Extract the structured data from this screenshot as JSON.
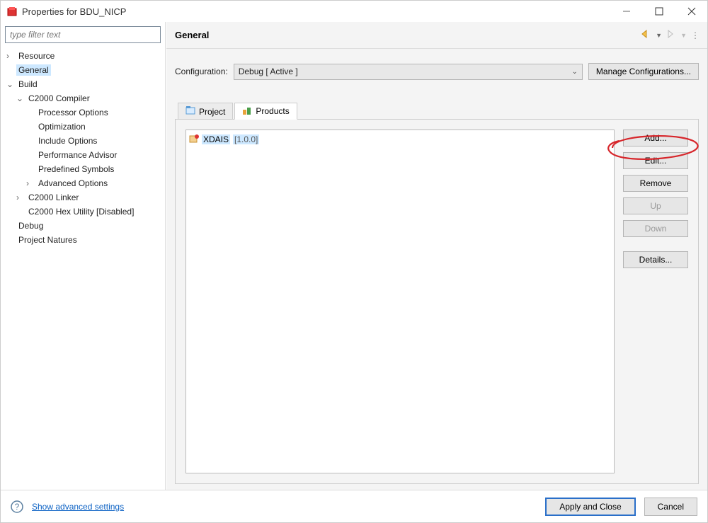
{
  "window": {
    "title": "Properties for BDU_NICP"
  },
  "sidebar": {
    "filter_placeholder": "type filter text",
    "tree": {
      "resource": "Resource",
      "general": "General",
      "build": "Build",
      "c2000_compiler": "C2000 Compiler",
      "processor_options": "Processor Options",
      "optimization": "Optimization",
      "include_options": "Include Options",
      "performance_advisor": "Performance Advisor",
      "predefined_symbols": "Predefined Symbols",
      "advanced_options": "Advanced Options",
      "c2000_linker": "C2000 Linker",
      "c2000_hex_utility": "C2000 Hex Utility  [Disabled]",
      "debug": "Debug",
      "project_natures": "Project Natures"
    }
  },
  "content": {
    "section_title": "General",
    "configuration_label": "Configuration:",
    "configuration_value": "Debug  [ Active ]",
    "manage_config_button": "Manage Configurations...",
    "tabs": {
      "project": "Project",
      "products": "Products"
    },
    "product_item": {
      "name": "XDAIS",
      "version": "[1.0.0]"
    },
    "buttons": {
      "add": "Add...",
      "edit": "Edit...",
      "remove": "Remove",
      "up": "Up",
      "down": "Down",
      "details": "Details..."
    }
  },
  "footer": {
    "advanced_link": "Show advanced settings",
    "apply": "Apply and Close",
    "cancel": "Cancel"
  }
}
